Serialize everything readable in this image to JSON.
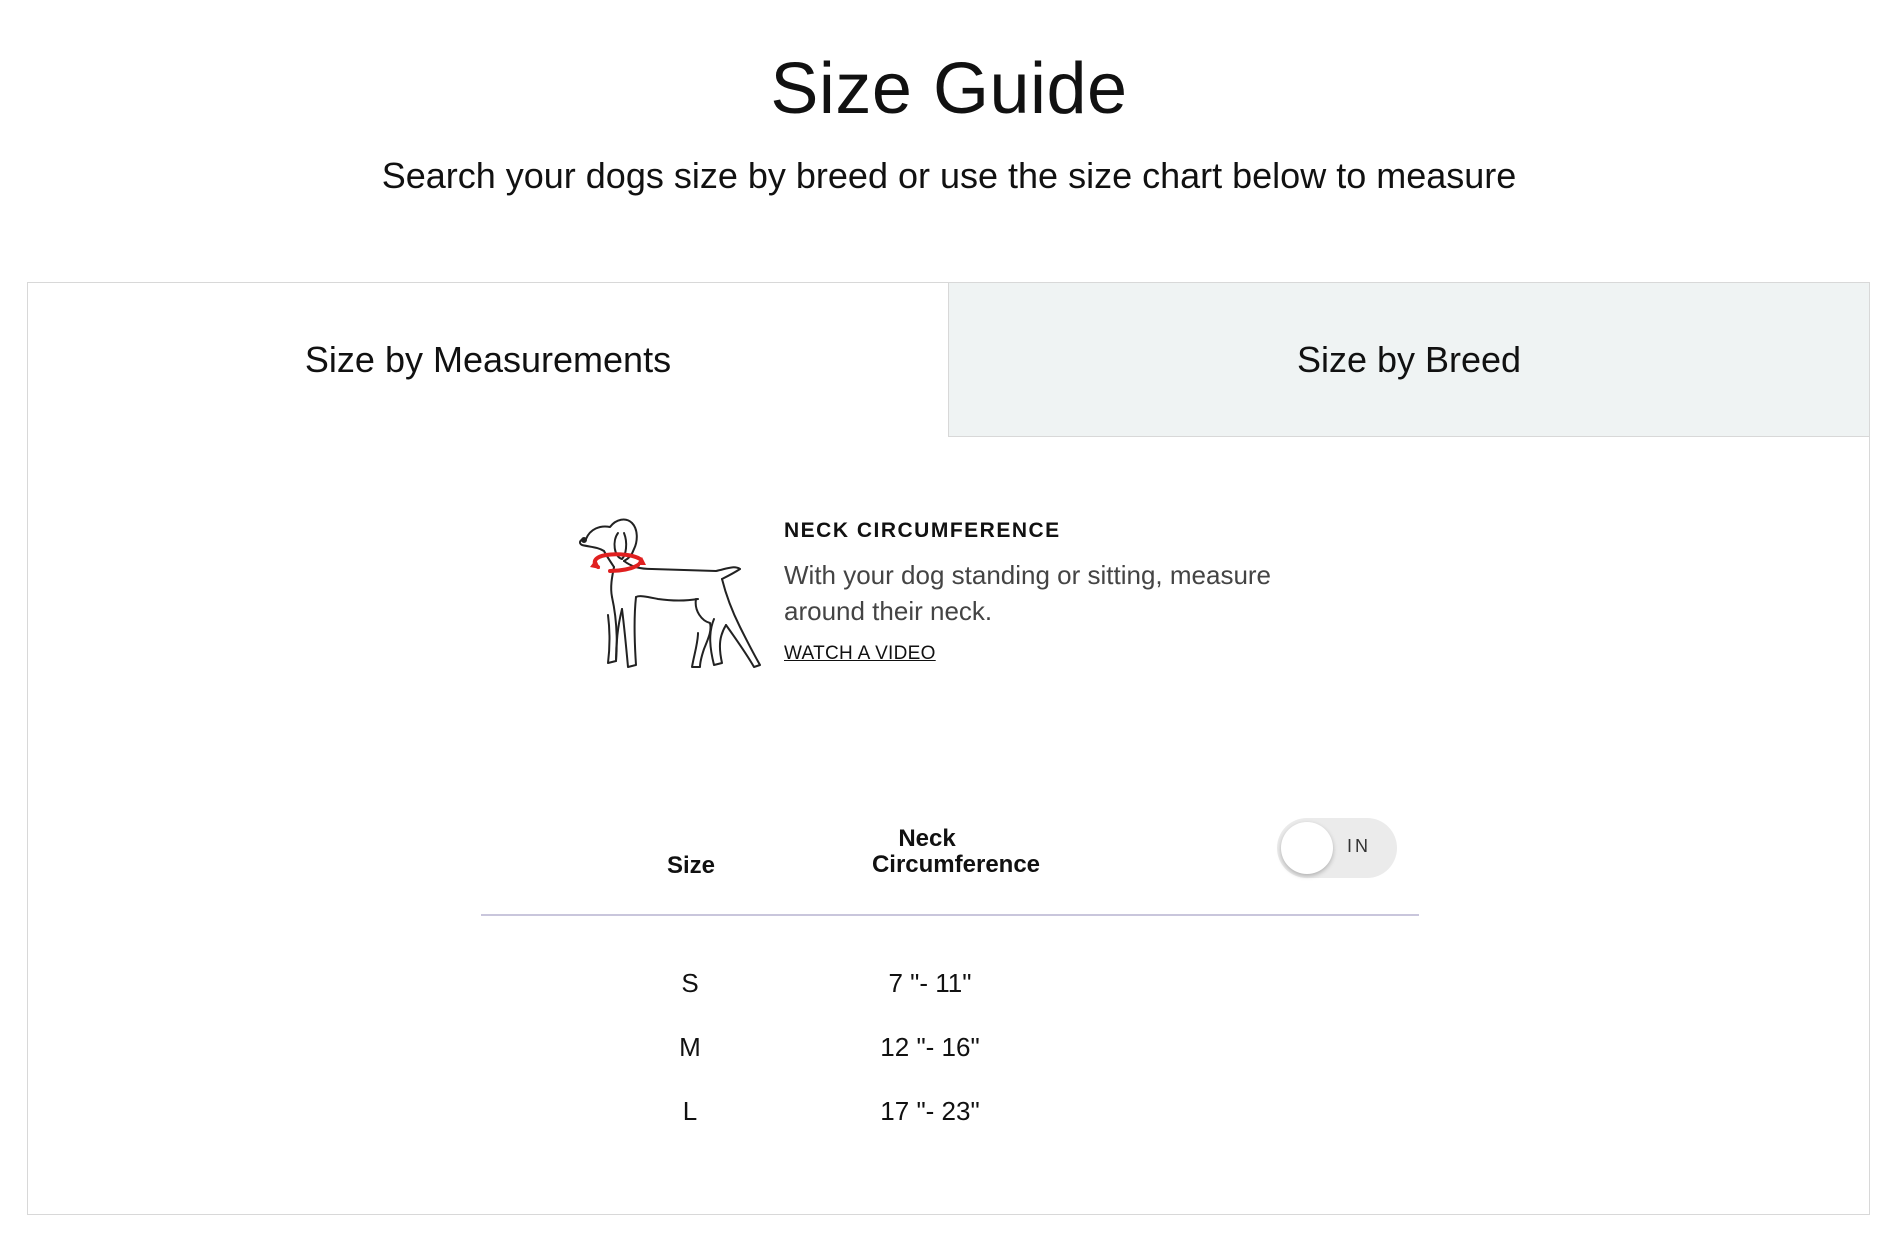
{
  "header": {
    "title": "Size Guide",
    "subtitle": "Search your dogs size by breed or use the size chart below to measure"
  },
  "tabs": [
    {
      "label": "Size by Measurements",
      "active": true
    },
    {
      "label": "Size by Breed",
      "active": false
    }
  ],
  "measurement": {
    "heading": "NECK CIRCUMFERENCE",
    "description": "With your dog standing or sitting, measure around their neck.",
    "link_label": "WATCH A VIDEO",
    "illustration_icon": "dog-neck-measure-icon",
    "accent_color": "#e02020"
  },
  "table": {
    "headers": {
      "size": "Size",
      "neck_line1": "Neck",
      "neck_line2": "Circumference"
    },
    "unit_toggle": {
      "label": "IN",
      "state": "off"
    },
    "rows": [
      {
        "size": "S",
        "neck": "7 \"- 11\""
      },
      {
        "size": "M",
        "neck": "12 \"- 16\""
      },
      {
        "size": "L",
        "neck": "17 \"- 23\""
      }
    ]
  },
  "colors": {
    "inactive_tab_bg": "#eff3f3",
    "border": "#d8d8d8",
    "table_rule": "#c9c6dc",
    "toggle_bg": "#ebebeb"
  }
}
